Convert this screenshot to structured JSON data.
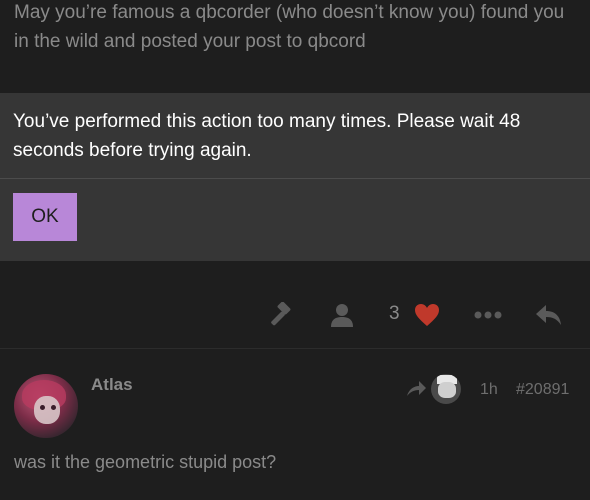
{
  "post": {
    "text": "May you’re famous a qbcorder (who doesn’t know you) found you in the wild and posted your post to qbcord",
    "actions": {
      "icons": [
        "hammer-icon",
        "user-icon",
        "heart-icon",
        "more-icon",
        "reply-icon"
      ],
      "like_count": "3"
    }
  },
  "modal": {
    "message": "You’ve performed this action too many times. Please wait 48 seconds before trying again.",
    "ok_label": "OK"
  },
  "reply": {
    "username": "Atlas",
    "age": "1h",
    "post_number": "#20891",
    "body": "was it the geometric stupid post?"
  },
  "colors": {
    "background": "#1e1e1e",
    "modal_background": "#363636",
    "button_accent": "#b887d8",
    "heart": "#c0392b",
    "muted_text": "#8a8a8a"
  }
}
